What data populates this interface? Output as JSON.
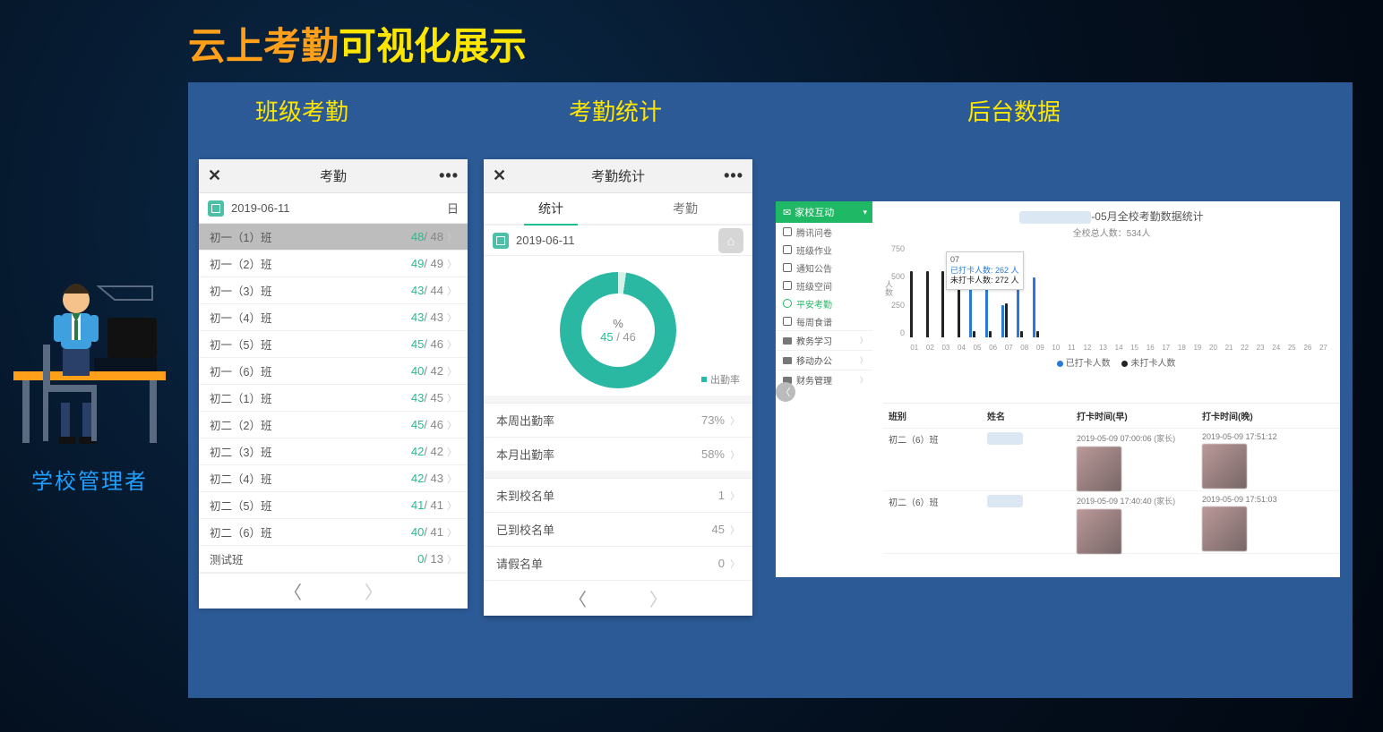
{
  "title_part1": "云上考勤",
  "title_part2": "可视化展示",
  "section_labels": {
    "class": "班级考勤",
    "stats": "考勤统计",
    "backend": "后台数据"
  },
  "admin_caption": "学校管理者",
  "phone1": {
    "title": "考勤",
    "date": "2019-06-11",
    "unit": "日",
    "classes": [
      {
        "name": "初一（1）班",
        "present": 48,
        "total": 48,
        "hl": true,
        "total_text": "48"
      },
      {
        "name": "初一（2）班",
        "present": 49,
        "total": 49
      },
      {
        "name": "初一（3）班",
        "present": 43,
        "total": 44
      },
      {
        "name": "初一（4）班",
        "present": 43,
        "total": 43
      },
      {
        "name": "初一（5）班",
        "present": 45,
        "total": 46
      },
      {
        "name": "初一（6）班",
        "present": 40,
        "total": 42
      },
      {
        "name": "初二（1）班",
        "present": 43,
        "total": 45
      },
      {
        "name": "初二（2）班",
        "present": 45,
        "total": 46
      },
      {
        "name": "初二（3）班",
        "present": 42,
        "total": 42
      },
      {
        "name": "初二（4）班",
        "present": 42,
        "total": 43
      },
      {
        "name": "初二（5）班",
        "present": 41,
        "total": 41
      },
      {
        "name": "初二（6）班",
        "present": 40,
        "total": 41
      },
      {
        "name": "测试班",
        "present": 0,
        "total": 13
      }
    ]
  },
  "phone2": {
    "title": "考勤统计",
    "tabs": {
      "stats": "统计",
      "attend": "考勤"
    },
    "date": "2019-06-11",
    "donut": {
      "pct_label": "%",
      "present": 45,
      "total": 46,
      "legend": "出勤率"
    },
    "rows": {
      "week": {
        "k": "本周出勤率",
        "v": "73%"
      },
      "month": {
        "k": "本月出勤率",
        "v": "58%"
      },
      "absent": {
        "k": "未到校名单",
        "v": "1"
      },
      "arrived": {
        "k": "已到校名单",
        "v": "45"
      },
      "leave": {
        "k": "请假名单",
        "v": "0"
      }
    }
  },
  "dashboard": {
    "side_header": "家校互动",
    "side_items": [
      {
        "label": "腾讯问卷"
      },
      {
        "label": "班级作业"
      },
      {
        "label": "通知公告"
      },
      {
        "label": "班级空间"
      },
      {
        "label": "平安考勤",
        "active": true
      },
      {
        "label": "每周食谱"
      }
    ],
    "side_groups": [
      {
        "label": "教务学习"
      },
      {
        "label": "移动办公"
      },
      {
        "label": "财务管理"
      }
    ],
    "chart": {
      "title_suffix": "-05月全校考勤数据统计",
      "subtitle": "全校总人数：534人",
      "y_label": "人数",
      "y_ticks": [
        750,
        500,
        250,
        0
      ],
      "legend_checked": "已打卡人数",
      "legend_unchecked": "未打卡人数",
      "tooltip_day": "07",
      "tooltip_checked": "已打卡人数: 262 人",
      "tooltip_unchecked": "未打卡人数: 272 人"
    },
    "table": {
      "headers": {
        "class": "班别",
        "name": "姓名",
        "early": "打卡时间(早)",
        "late": "打卡时间(晚)"
      },
      "rows": [
        {
          "class": "初二（6）班",
          "early": "2019-05-09 07:00:06",
          "early_role": "(家长)",
          "late": "2019-05-09 17:51:12"
        },
        {
          "class": "初二（6）班",
          "early": "2019-05-09 17:40:40",
          "early_role": "(家长)",
          "late": "2019-05-09 17:51:03"
        }
      ]
    }
  },
  "chart_data": {
    "type": "bar",
    "title": "05月全校考勤数据统计",
    "subtitle": "全校总人数：534人",
    "xlabel": "",
    "ylabel": "人数",
    "ylim": [
      0,
      750
    ],
    "x": [
      1,
      2,
      3,
      4,
      5,
      6,
      7,
      8,
      9,
      10,
      11,
      12,
      13,
      14,
      15,
      16,
      17,
      18,
      19,
      20,
      21,
      22,
      23,
      24,
      25,
      26,
      27
    ],
    "series": [
      {
        "name": "已打卡人数",
        "color": "#2b79d6",
        "values": [
          0,
          0,
          0,
          0,
          480,
          480,
          262,
          480,
          480,
          0,
          0,
          0,
          0,
          0,
          0,
          0,
          0,
          0,
          0,
          0,
          0,
          0,
          0,
          0,
          0,
          0,
          0
        ]
      },
      {
        "name": "未打卡人数",
        "color": "#222222",
        "values": [
          534,
          534,
          534,
          534,
          54,
          54,
          272,
          54,
          54,
          0,
          0,
          0,
          0,
          0,
          0,
          0,
          0,
          0,
          0,
          0,
          0,
          0,
          0,
          0,
          0,
          0,
          0
        ]
      }
    ]
  }
}
